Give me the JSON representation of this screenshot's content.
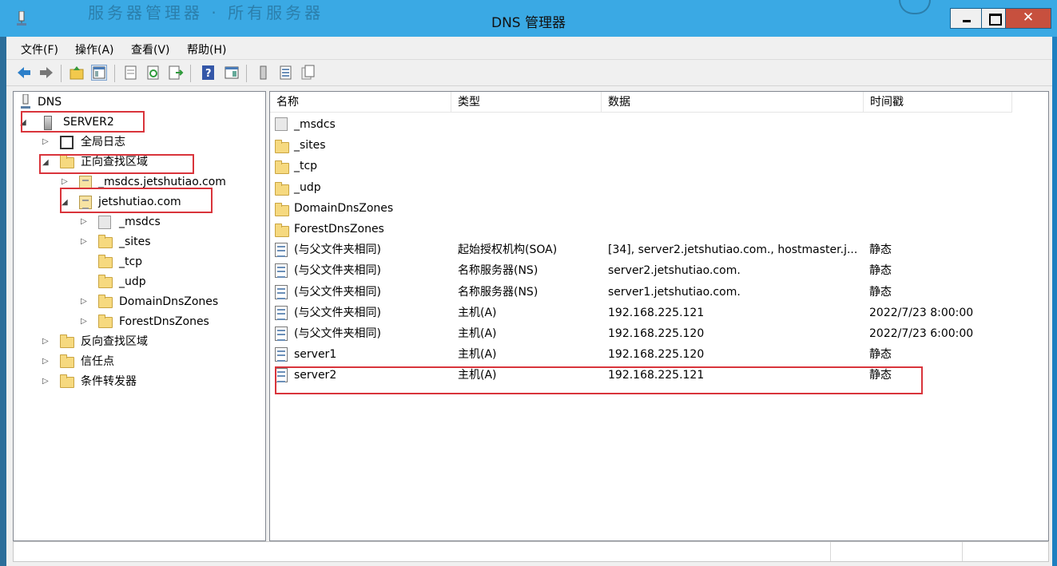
{
  "window": {
    "title": "DNS 管理器",
    "background_text": "服务器管理器 · 所有服务器",
    "close_glyph": "✕"
  },
  "menu": [
    "文件(F)",
    "操作(A)",
    "查看(V)",
    "帮助(H)"
  ],
  "toolbar_icons": [
    "back-arrow-icon",
    "forward-arrow-icon",
    "up-folder-icon",
    "show-hide-tree-icon",
    "properties-icon",
    "refresh-icon",
    "export-list-icon",
    "help-icon",
    "action-pane-icon",
    "server-icon",
    "zone-icon",
    "copy-zone-icon"
  ],
  "tree": {
    "root": "DNS",
    "server": "SERVER2",
    "global_logs": "全局日志",
    "forward_zones": "正向查找区域",
    "msdcs_zone": "_msdcs.jetshutiao.com",
    "main_zone": "jetshutiao.com",
    "sub_msdcs": "_msdcs",
    "sub_sites": "_sites",
    "sub_tcp": "_tcp",
    "sub_udp": "_udp",
    "sub_domain": "DomainDnsZones",
    "sub_forest": "ForestDnsZones",
    "reverse_zones": "反向查找区域",
    "trust_points": "信任点",
    "conditional_forwarders": "条件转发器"
  },
  "columns": {
    "name": "名称",
    "type": "类型",
    "data": "数据",
    "timestamp": "时间戳"
  },
  "records": [
    {
      "name": "_msdcs",
      "type": "",
      "data": "",
      "timestamp": "",
      "icon": "gray-folder-icon"
    },
    {
      "name": "_sites",
      "type": "",
      "data": "",
      "timestamp": "",
      "icon": "folder-icon"
    },
    {
      "name": "_tcp",
      "type": "",
      "data": "",
      "timestamp": "",
      "icon": "folder-icon"
    },
    {
      "name": "_udp",
      "type": "",
      "data": "",
      "timestamp": "",
      "icon": "folder-icon"
    },
    {
      "name": "DomainDnsZones",
      "type": "",
      "data": "",
      "timestamp": "",
      "icon": "folder-icon"
    },
    {
      "name": "ForestDnsZones",
      "type": "",
      "data": "",
      "timestamp": "",
      "icon": "folder-icon"
    },
    {
      "name": "(与父文件夹相同)",
      "type": "起始授权机构(SOA)",
      "data": "[34], server2.jetshutiao.com., hostmaster.j...",
      "timestamp": "静态",
      "icon": "record-icon"
    },
    {
      "name": "(与父文件夹相同)",
      "type": "名称服务器(NS)",
      "data": "server2.jetshutiao.com.",
      "timestamp": "静态",
      "icon": "record-icon"
    },
    {
      "name": "(与父文件夹相同)",
      "type": "名称服务器(NS)",
      "data": "server1.jetshutiao.com.",
      "timestamp": "静态",
      "icon": "record-icon"
    },
    {
      "name": "(与父文件夹相同)",
      "type": "主机(A)",
      "data": "192.168.225.121",
      "timestamp": "2022/7/23 8:00:00",
      "icon": "record-icon"
    },
    {
      "name": "(与父文件夹相同)",
      "type": "主机(A)",
      "data": "192.168.225.120",
      "timestamp": "2022/7/23 6:00:00",
      "icon": "record-icon"
    },
    {
      "name": "server1",
      "type": "主机(A)",
      "data": "192.168.225.120",
      "timestamp": "静态",
      "icon": "record-icon"
    },
    {
      "name": "server2",
      "type": "主机(A)",
      "data": "192.168.225.121",
      "timestamp": "静态",
      "icon": "record-icon"
    }
  ],
  "colors": {
    "titlebar": "#3aa9e4",
    "close_button": "#c7503e",
    "highlight_box": "#d9343b",
    "folder": "#f6d97f"
  }
}
